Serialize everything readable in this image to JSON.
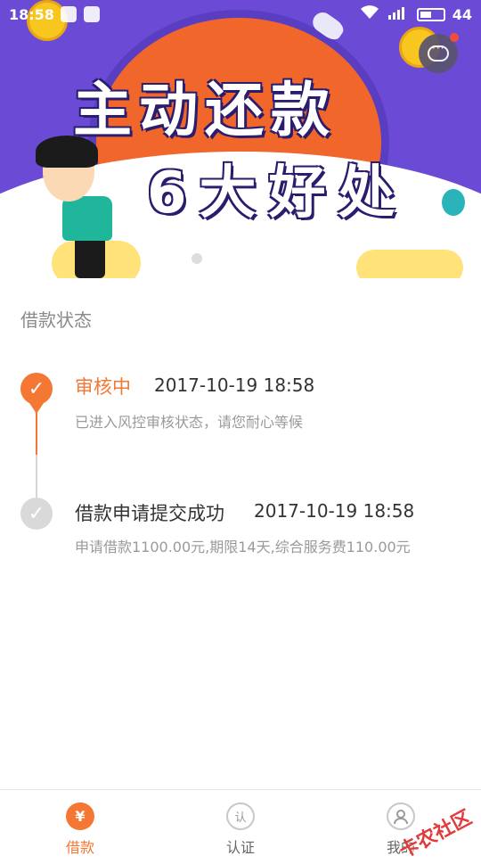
{
  "status_bar": {
    "time": "18:58",
    "battery": "44",
    "network": "4G"
  },
  "banner": {
    "line1": "主动还款",
    "line2": "6大好处",
    "slide_count": 2,
    "active_slide": 2
  },
  "colors": {
    "accent": "#f47733",
    "banner_bg": "#6b4ad6",
    "banner_circle": "#f1662b"
  },
  "section": {
    "title": "借款状态"
  },
  "timeline": [
    {
      "status": "审核中",
      "time": "2017-10-19 18:58",
      "desc": "已进入风控审核状态，请您耐心等候",
      "icon": "check-icon",
      "state": "active"
    },
    {
      "status": "借款申请提交成功",
      "time": "2017-10-19 18:58",
      "desc": "申请借款1100.00元,期限14天,综合服务费110.00元",
      "icon": "check-icon",
      "state": "done"
    }
  ],
  "tabs": [
    {
      "label": "借款",
      "icon_glyph": "¥",
      "icon": "yuan-icon",
      "active": true
    },
    {
      "label": "认证",
      "icon_glyph": "认",
      "icon": "verify-icon",
      "active": false
    },
    {
      "label": "我的",
      "icon_glyph": "",
      "icon": "user-icon",
      "active": false
    }
  ],
  "watermark": "卡农社区"
}
